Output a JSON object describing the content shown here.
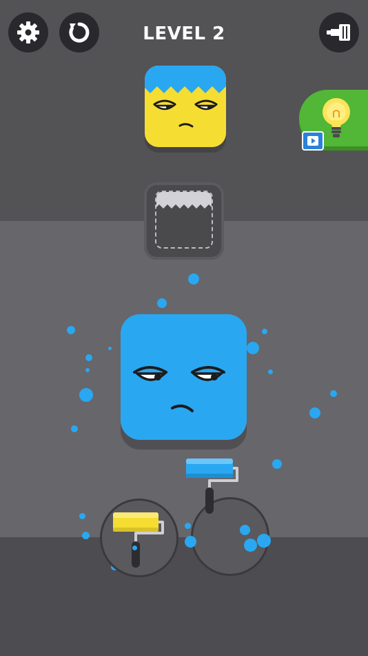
{
  "header": {
    "level_label": "LEVEL 2",
    "settings_icon": "gear-icon",
    "restart_icon": "restart-icon",
    "shop_icon": "paint-roller-icon"
  },
  "hint": {
    "icon": "lightbulb-icon",
    "badge_icon": "video-play-icon"
  },
  "colors": {
    "top_band": "#535255",
    "mid_band": "#67666b",
    "bottom_band": "#4d4c50",
    "paint_blue": "#2aa7f1",
    "paint_yellow": "#f6dd32",
    "hint_green": "#52b636"
  },
  "rollers": [
    {
      "name": "yellow-roller",
      "color": "#f6dd32"
    },
    {
      "name": "blue-roller",
      "color": "#2aa7f1"
    }
  ]
}
